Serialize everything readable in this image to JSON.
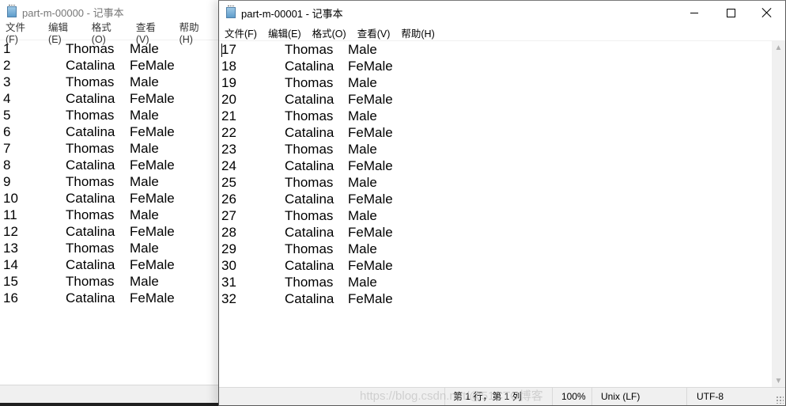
{
  "back_window": {
    "title": "part-m-00000 - 记事本",
    "menu": [
      "文件(F)",
      "编辑(E)",
      "格式(O)",
      "查看(V)",
      "帮助(H)"
    ],
    "rows": [
      [
        "1",
        "Thomas",
        "Male"
      ],
      [
        "2",
        "Catalina",
        "FeMale"
      ],
      [
        "3",
        "Thomas",
        "Male"
      ],
      [
        "4",
        "Catalina",
        "FeMale"
      ],
      [
        "5",
        "Thomas",
        "Male"
      ],
      [
        "6",
        "Catalina",
        "FeMale"
      ],
      [
        "7",
        "Thomas",
        "Male"
      ],
      [
        "8",
        "Catalina",
        "FeMale"
      ],
      [
        "9",
        "Thomas",
        "Male"
      ],
      [
        "10",
        "Catalina",
        "FeMale"
      ],
      [
        "11",
        "Thomas",
        "Male"
      ],
      [
        "12",
        "Catalina",
        "FeMale"
      ],
      [
        "13",
        "Thomas",
        "Male"
      ],
      [
        "14",
        "Catalina",
        "FeMale"
      ],
      [
        "15",
        "Thomas",
        "Male"
      ],
      [
        "16",
        "Catalina",
        "FeMale"
      ]
    ]
  },
  "front_window": {
    "title": "part-m-00001 - 记事本",
    "menu": [
      "文件(F)",
      "编辑(E)",
      "格式(O)",
      "查看(V)",
      "帮助(H)"
    ],
    "rows": [
      [
        "17",
        "Thomas",
        "Male"
      ],
      [
        "18",
        "Catalina",
        "FeMale"
      ],
      [
        "19",
        "Thomas",
        "Male"
      ],
      [
        "20",
        "Catalina",
        "FeMale"
      ],
      [
        "21",
        "Thomas",
        "Male"
      ],
      [
        "22",
        "Catalina",
        "FeMale"
      ],
      [
        "23",
        "Thomas",
        "Male"
      ],
      [
        "24",
        "Catalina",
        "FeMale"
      ],
      [
        "25",
        "Thomas",
        "Male"
      ],
      [
        "26",
        "Catalina",
        "FeMale"
      ],
      [
        "27",
        "Thomas",
        "Male"
      ],
      [
        "28",
        "Catalina",
        "FeMale"
      ],
      [
        "29",
        "Thomas",
        "Male"
      ],
      [
        "30",
        "Catalina",
        "FeMale"
      ],
      [
        "31",
        "Thomas",
        "Male"
      ],
      [
        "32",
        "Catalina",
        "FeMale"
      ]
    ],
    "status": {
      "position": "第 1 行，第 1 列",
      "zoom": "100%",
      "line_ending": "Unix (LF)",
      "encoding": "UTF-8"
    },
    "controls": {
      "minimize": "minimize",
      "maximize": "maximize",
      "close": "close"
    }
  },
  "watermark": "https://blog.csdn.net/@51CTO博客"
}
